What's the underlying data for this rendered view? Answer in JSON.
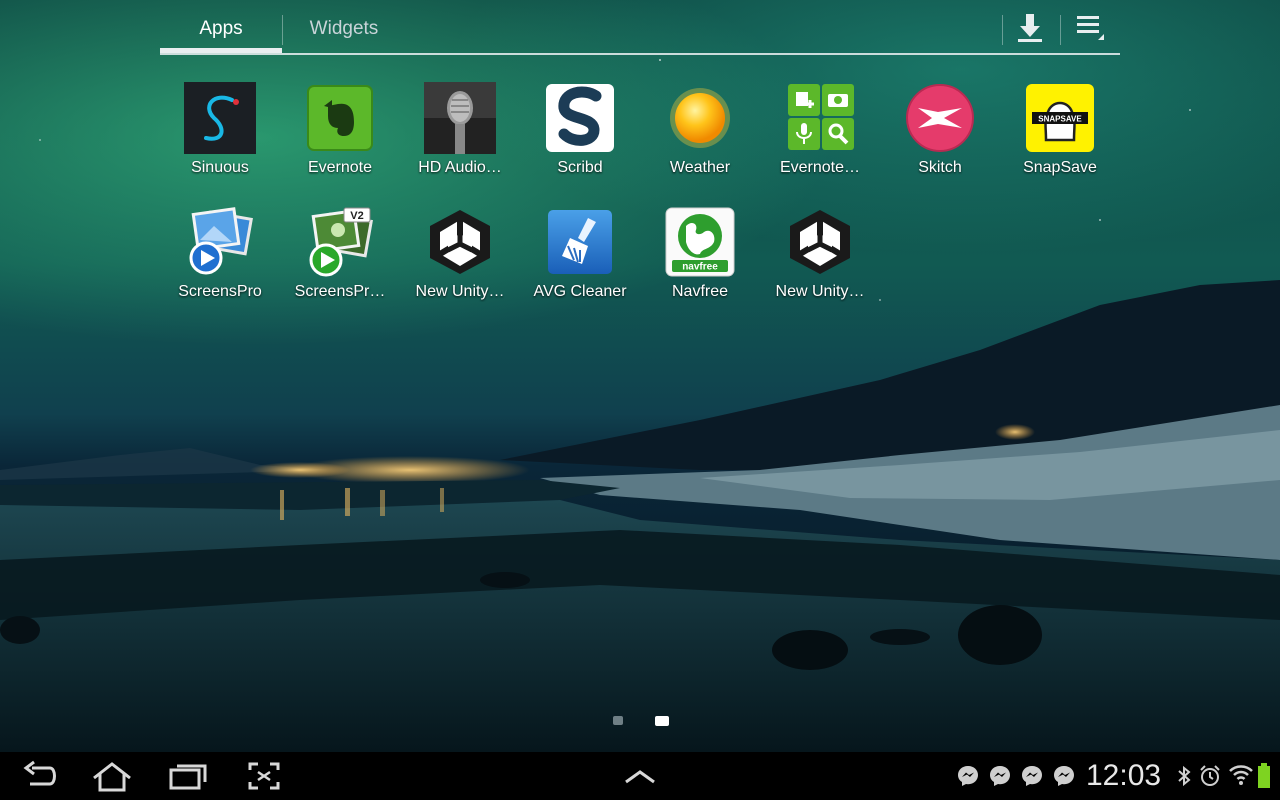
{
  "tabs": [
    {
      "label": "Apps",
      "active": true
    },
    {
      "label": "Widgets",
      "active": false
    }
  ],
  "toolbar": {
    "download_icon": "download-icon",
    "menu_icon": "overflow-menu-icon"
  },
  "apps": [
    {
      "label": "Sinuous",
      "icon": "sinuous-icon"
    },
    {
      "label": "Evernote",
      "icon": "evernote-icon"
    },
    {
      "label": "HD Audio…",
      "icon": "microphone-icon"
    },
    {
      "label": "Scribd",
      "icon": "scribd-icon"
    },
    {
      "label": "Weather",
      "icon": "sun-icon"
    },
    {
      "label": "Evernote…",
      "icon": "evernote-widget-icon"
    },
    {
      "label": "Skitch",
      "icon": "skitch-icon"
    },
    {
      "label": "SnapSave",
      "icon": "snapsave-icon"
    },
    {
      "label": "ScreensPro",
      "icon": "screenspro-icon"
    },
    {
      "label": "ScreensPr…",
      "icon": "screenspro-v2-icon",
      "badge": "V2"
    },
    {
      "label": "New Unity…",
      "icon": "unity-icon"
    },
    {
      "label": "AVG Cleaner",
      "icon": "avg-cleaner-icon"
    },
    {
      "label": "Navfree",
      "icon": "navfree-icon",
      "badge": "navfree"
    },
    {
      "label": "New Unity…",
      "icon": "unity-icon"
    }
  ],
  "snapsave_badge": "SNAPSAVE",
  "pager": {
    "pages": 2,
    "current": 2
  },
  "system_bar": {
    "clock": "12:03",
    "nav": [
      "back-icon",
      "home-icon",
      "recent-apps-icon",
      "screenshot-icon",
      "up-arrow-icon"
    ],
    "notifications": [
      "messenger-icon",
      "messenger-icon",
      "messenger-icon",
      "messenger-icon"
    ],
    "status": [
      "bluetooth-icon",
      "alarm-icon",
      "wifi-icon",
      "battery-icon"
    ]
  },
  "colors": {
    "accent": "#e9eef0",
    "battery": "#7ed321",
    "system_bar": "#000000"
  }
}
